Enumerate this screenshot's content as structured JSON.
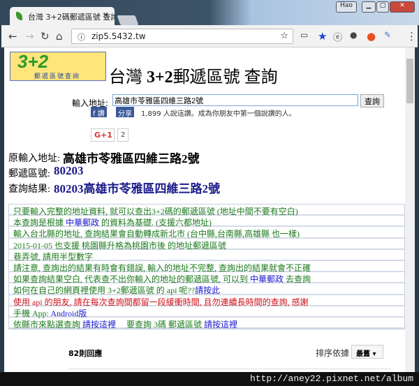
{
  "browser": {
    "tab_title": "台灣 3+2碼郵遞區號 查詢",
    "url": "zip5.5432.tw",
    "user": "Hao"
  },
  "logo": {
    "big": "3+2",
    "small": "郵遞區號查詢"
  },
  "heading": {
    "pre": "台灣 ",
    "bold": "3+2",
    "post": "郵遞區號 查詢"
  },
  "form": {
    "label": "輸入地址:",
    "value": "高雄市苓雅區四維三路2號",
    "button": "查詢"
  },
  "social": {
    "like": "f 讚",
    "share": "分享",
    "like_text": "1,899 人說這讚。成為你朋友中第一個說讚的人。",
    "gplus": "G+1",
    "gplus_count": "2"
  },
  "result": {
    "orig_label": "原輸入地址:",
    "orig_value": "高雄市苓雅區四維三路2號",
    "zip_label": "郵遞區號:",
    "zip_value": "80203",
    "result_label": "查詢結果:",
    "result_value": "80203高雄市苓雅區四維三路2號"
  },
  "notices": [
    {
      "t1": "只要輸入完整的地址資料, 就可以查出3+2碼的郵遞區號 (地址中間不要有空白)"
    },
    {
      "t1": "本查詢是根據 ",
      "link": "中華郵政",
      "t2": " 的資料為基礎. (支援六都地址)"
    },
    {
      "t1": "輸入台北縣的地址, 查詢結果會自動轉成新北市 (台中縣,台南縣,高雄縣 也一樣)"
    },
    {
      "t1": "2015-01-05 也支援 桃園縣升格為桃園市後 的地址郵遞區號"
    },
    {
      "t1": "巷弄號, 請用半型數字"
    },
    {
      "t1": "請注意, 查詢出的結果有時會有錯誤, 輸入的地址不完整, 查詢出的結果就會不正確"
    },
    {
      "t1": "如果查詢結果空白, 代表查不出你輸入的地址的郵遞區號, 可以到 ",
      "link": "中華郵政",
      "t2": " 去查詢"
    },
    {
      "t1": "如何在自己的網頁裡使用 3+2郵遞區號 的 api 呢??",
      "link": "請按此"
    },
    {
      "t1": "使用 api 的朋友, 請在每次查詢間都留一段緩衝時間, 且勿連續長時間的查詢, 感謝"
    },
    {
      "t1": "手機 App: ",
      "link": "Android版"
    },
    {
      "t1": "依縣市來點選查詢 ",
      "link": "請按這裡",
      "t2": "　 要查詢 3碼 郵遞區號 ",
      "link2": "請按這裡"
    }
  ],
  "comments": {
    "count": "82則回應",
    "sort_label": "排序依據",
    "sort_value": "最舊 ▾"
  },
  "watermark": "http://aney22.pixnet.net/album"
}
